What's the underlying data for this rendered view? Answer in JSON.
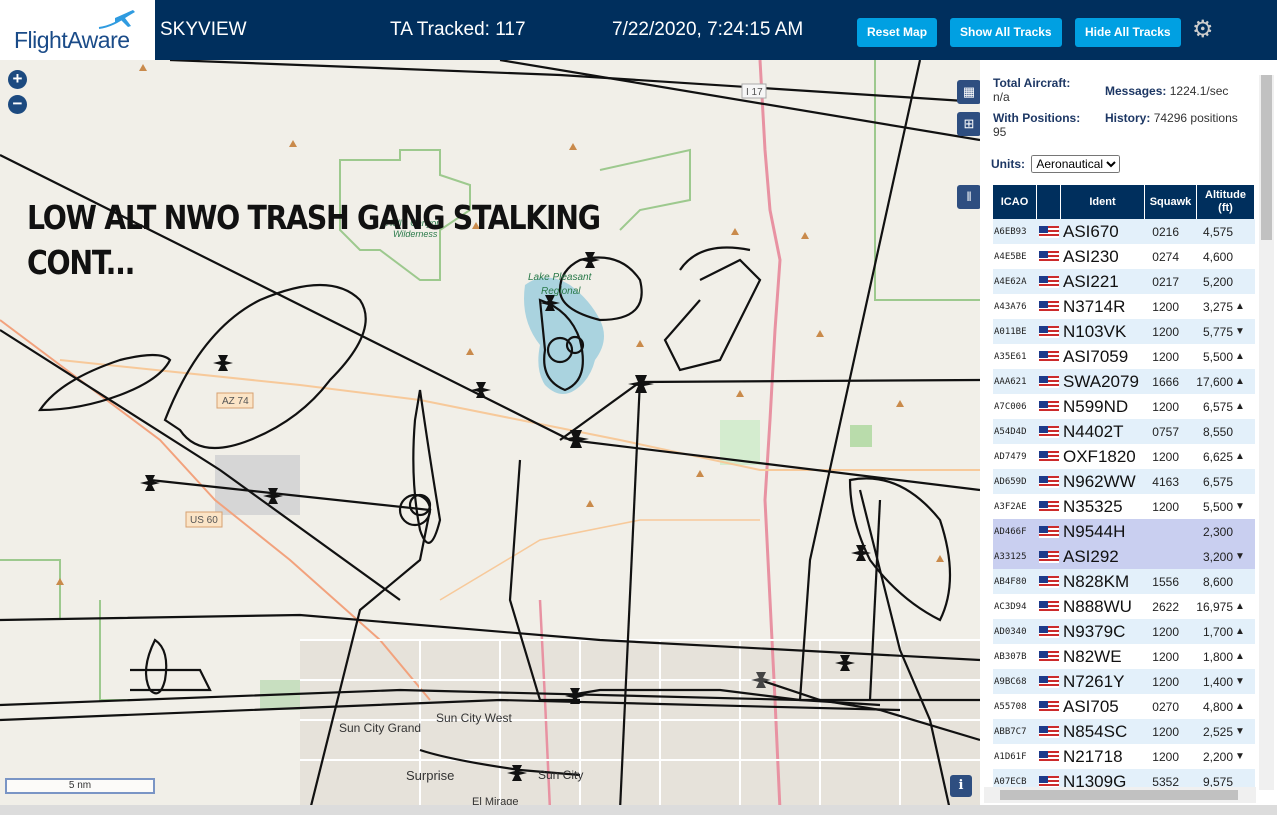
{
  "header": {
    "logo_text": "FlightAware",
    "app_name": "SKYVIEW",
    "ta_tracked": "TA Tracked: 117",
    "clock": "7/22/2020, 7:24:15 AM",
    "buttons": {
      "reset": "Reset Map",
      "show": "Show All Tracks",
      "hide": "Hide All Tracks"
    },
    "settings_icon": "gear-icon"
  },
  "map": {
    "zoom_in": "+",
    "zoom_out": "−",
    "overlay_text": "LOW ALT NWO TRASH GANG STALKING\nCONT...",
    "scale_label": "5 nm",
    "info_label": "i",
    "labels": {
      "lake": "Lake Pleasant\nRegional",
      "wilderness": "Hell's Canyon\nWilderness",
      "az74": "AZ 74",
      "us60": "US 60",
      "i17": "I 17",
      "sun_city_grand": "Sun City Grand",
      "sun_city_west": "Sun City West",
      "surprise": "Surprise",
      "sun_city": "Sun City",
      "el_mirage": "El Mirage"
    }
  },
  "panel": {
    "total_aircraft_label": "Total Aircraft:",
    "total_aircraft_value": "n/a",
    "messages_label": "Messages:",
    "messages_value": "1224.1/sec",
    "with_positions_label": "With Positions:",
    "with_positions_value": "95",
    "history_label": "History:",
    "history_value": "74296 positions",
    "units_label": "Units:",
    "units_value": "Aeronautical",
    "columns": {
      "icao": "ICAO",
      "ident": "Ident",
      "squawk": "Squawk",
      "altitude": "Altitude (ft)"
    },
    "rows": [
      {
        "icao": "A6EB93",
        "ident": "ASI670",
        "squawk": "0216",
        "alt": "4,575",
        "ind": ""
      },
      {
        "icao": "A4E5BE",
        "ident": "ASI230",
        "squawk": "0274",
        "alt": "4,600",
        "ind": ""
      },
      {
        "icao": "A4E62A",
        "ident": "ASI221",
        "squawk": "0217",
        "alt": "5,200",
        "ind": ""
      },
      {
        "icao": "A43A76",
        "ident": "N3714R",
        "squawk": "1200",
        "alt": "3,275",
        "ind": "▲"
      },
      {
        "icao": "A011BE",
        "ident": "N103VK",
        "squawk": "1200",
        "alt": "5,775",
        "ind": "▼"
      },
      {
        "icao": "A35E61",
        "ident": "ASI7059",
        "squawk": "1200",
        "alt": "5,500",
        "ind": "▲"
      },
      {
        "icao": "AAA621",
        "ident": "SWA2079",
        "squawk": "1666",
        "alt": "17,600",
        "ind": "▲"
      },
      {
        "icao": "A7C006",
        "ident": "N599ND",
        "squawk": "1200",
        "alt": "6,575",
        "ind": "▲"
      },
      {
        "icao": "A54D4D",
        "ident": "N4402T",
        "squawk": "0757",
        "alt": "8,550",
        "ind": ""
      },
      {
        "icao": "AD7479",
        "ident": "OXF1820",
        "squawk": "1200",
        "alt": "6,625",
        "ind": "▲"
      },
      {
        "icao": "AD659D",
        "ident": "N962WW",
        "squawk": "4163",
        "alt": "6,575",
        "ind": ""
      },
      {
        "icao": "A3F2AE",
        "ident": "N35325",
        "squawk": "1200",
        "alt": "5,500",
        "ind": "▼"
      },
      {
        "icao": "AD466F",
        "ident": "N9544H",
        "squawk": "",
        "alt": "2,300",
        "ind": "",
        "selected": true
      },
      {
        "icao": "A33125",
        "ident": "ASI292",
        "squawk": "",
        "alt": "3,200",
        "ind": "▼",
        "selected": true
      },
      {
        "icao": "AB4F80",
        "ident": "N828KM",
        "squawk": "1556",
        "alt": "8,600",
        "ind": ""
      },
      {
        "icao": "AC3D94",
        "ident": "N888WU",
        "squawk": "2622",
        "alt": "16,975",
        "ind": "▲"
      },
      {
        "icao": "AD0340",
        "ident": "N9379C",
        "squawk": "1200",
        "alt": "1,700",
        "ind": "▲"
      },
      {
        "icao": "AB307B",
        "ident": "N82WE",
        "squawk": "1200",
        "alt": "1,800",
        "ind": "▲"
      },
      {
        "icao": "A9BC68",
        "ident": "N7261Y",
        "squawk": "1200",
        "alt": "1,400",
        "ind": "▼"
      },
      {
        "icao": "A55708",
        "ident": "ASI705",
        "squawk": "0270",
        "alt": "4,800",
        "ind": "▲"
      },
      {
        "icao": "ABB7C7",
        "ident": "N854SC",
        "squawk": "1200",
        "alt": "2,525",
        "ind": "▼"
      },
      {
        "icao": "A1D61F",
        "ident": "N21718",
        "squawk": "1200",
        "alt": "2,200",
        "ind": "▼"
      },
      {
        "icao": "A07ECB",
        "ident": "N1309G",
        "squawk": "5352",
        "alt": "9,575",
        "ind": ""
      }
    ]
  }
}
